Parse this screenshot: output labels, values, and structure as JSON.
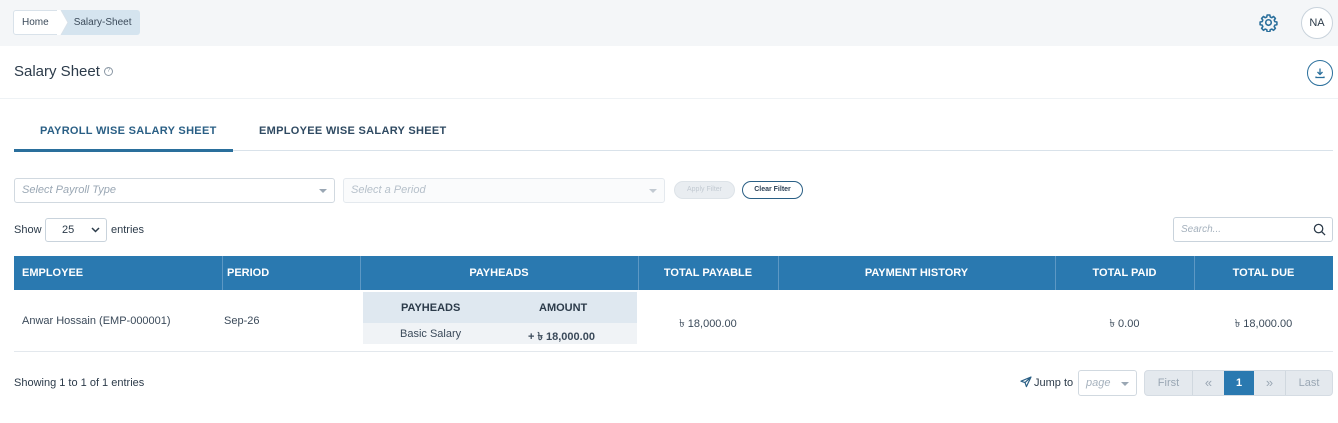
{
  "breadcrumb": {
    "home": "Home",
    "current": "Salary-Sheet"
  },
  "user": {
    "initials": "NA"
  },
  "page": {
    "title": "Salary Sheet",
    "help": "?"
  },
  "tabs": [
    {
      "label": "PAYROLL WISE SALARY SHEET",
      "active": true
    },
    {
      "label": "EMPLOYEE WISE SALARY SHEET",
      "active": false
    }
  ],
  "filters": {
    "payroll_placeholder": "Select Payroll Type",
    "period_placeholder": "Select a Period",
    "apply_label": "Apply Filter",
    "clear_label": "Clear Filter"
  },
  "entries": {
    "show_label": "Show",
    "value": "25",
    "suffix": "entries"
  },
  "search": {
    "placeholder": "Search..."
  },
  "table": {
    "headers": [
      "EMPLOYEE",
      "PERIOD",
      "PAYHEADS",
      "TOTAL PAYABLE",
      "PAYMENT HISTORY",
      "TOTAL PAID",
      "TOTAL DUE"
    ],
    "rows": [
      {
        "employee": "Anwar Hossain (EMP-000001)",
        "period": "Sep-26",
        "payheads": {
          "headers": [
            "PAYHEADS",
            "AMOUNT"
          ],
          "items": [
            {
              "name": "Basic Salary",
              "amount": "+ ৳ 18,000.00"
            }
          ]
        },
        "total_payable": "৳ 18,000.00",
        "payment_history": "",
        "total_paid": "৳ 0.00",
        "total_due": "৳ 18,000.00"
      }
    ]
  },
  "footer": {
    "showing": "Showing 1 to 1 of 1 entries",
    "jump_label": "Jump to",
    "page_placeholder": "page",
    "pager": {
      "first": "First",
      "prev": "«",
      "current": "1",
      "next": "»",
      "last": "Last"
    }
  },
  "colors": {
    "accent": "#2a79b0",
    "accent_dark": "#2a5f85"
  }
}
